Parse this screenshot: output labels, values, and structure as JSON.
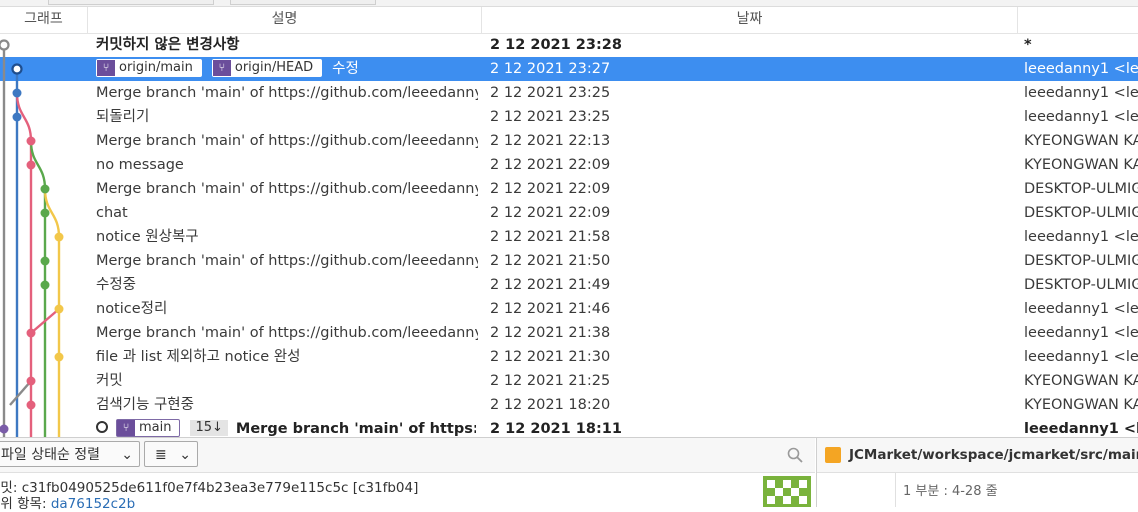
{
  "columns": {
    "graph": "그래프",
    "description": "설명",
    "date": "날짜"
  },
  "commits": [
    {
      "desc": "커밋하지 않은 변경사항",
      "date": "",
      "author": "*",
      "bold": true
    },
    {
      "tags": [
        "origin/main",
        "origin/HEAD"
      ],
      "desc": "수정",
      "date": "2 12 2021 23:27",
      "author": "leeedanny1 <lee",
      "selected": true
    },
    {
      "desc": "Merge branch 'main' of https://github.com/leeedanny1/",
      "date": "2 12 2021 23:25",
      "author": "leeedanny1 <lee"
    },
    {
      "desc": "되돌리기",
      "date": "2 12 2021 23:25",
      "author": "leeedanny1 <lee"
    },
    {
      "desc": "Merge branch 'main' of https://github.com/leeedanny1/",
      "date": "2 12 2021 22:13",
      "author": "KYEONGWAN KA"
    },
    {
      "desc": "no message",
      "date": "2 12 2021 22:09",
      "author": "KYEONGWAN KA"
    },
    {
      "desc": "Merge branch 'main' of https://github.com/leeedanny1/",
      "date": "2 12 2021 22:09",
      "author": "DESKTOP-ULMIG"
    },
    {
      "desc": "chat",
      "date": "2 12 2021 22:09",
      "author": "DESKTOP-ULMIG"
    },
    {
      "desc": "notice 원상복구",
      "date": "2 12 2021 21:58",
      "author": "leeedanny1 <lee"
    },
    {
      "desc": "Merge branch 'main' of https://github.com/leeedanny1/",
      "date": "2 12 2021 21:50",
      "author": "DESKTOP-ULMIG"
    },
    {
      "desc": "수정중",
      "date": "2 12 2021 21:49",
      "author": "DESKTOP-ULMIG"
    },
    {
      "desc": "notice정리",
      "date": "2 12 2021 21:46",
      "author": "leeedanny1 <lee"
    },
    {
      "desc": "Merge branch 'main' of https://github.com/leeedanny1/",
      "date": "2 12 2021 21:38",
      "author": "leeedanny1 <lee"
    },
    {
      "desc": "file 과 list 제외하고 notice 완성",
      "date": "2 12 2021 21:30",
      "author": "leeedanny1 <lee"
    },
    {
      "desc": "커밋",
      "date": "2 12 2021 21:25",
      "author": "KYEONGWAN KA"
    },
    {
      "desc": "검색기능 구현중",
      "date": "2 12 2021 18:20",
      "author": "KYEONGWAN KA"
    },
    {
      "tags": [
        "main"
      ],
      "count": "15↓",
      "desc": "Merge branch 'main' of https://git",
      "date": "2 12 2021 18:11",
      "author": "leeedanny1 <lee",
      "bold": true
    }
  ],
  "dateFirstRow": "2 12 2021 23:28",
  "graphColors": {
    "gray": "#8a8a8a",
    "blue": "#3d78c2",
    "pink": "#e4607c",
    "green": "#5aa84c",
    "yellow": "#f2c74a",
    "purple": "#7a5ca8"
  },
  "bottom": {
    "sort_label": "파일 상태순 정렬",
    "list_glyph": "≣",
    "commit_label": "커밋:",
    "commit_hash": "c31fb0490525de611f0e7f4b23ea3e779e115c5c [c31fb04]",
    "parent_label": "상위 항목:",
    "parent_hash": "da76152c2b",
    "file_path": "JCMarket/workspace/jcmarket/src/main/java",
    "hunk": "1 부분 : 4-28 줄"
  }
}
